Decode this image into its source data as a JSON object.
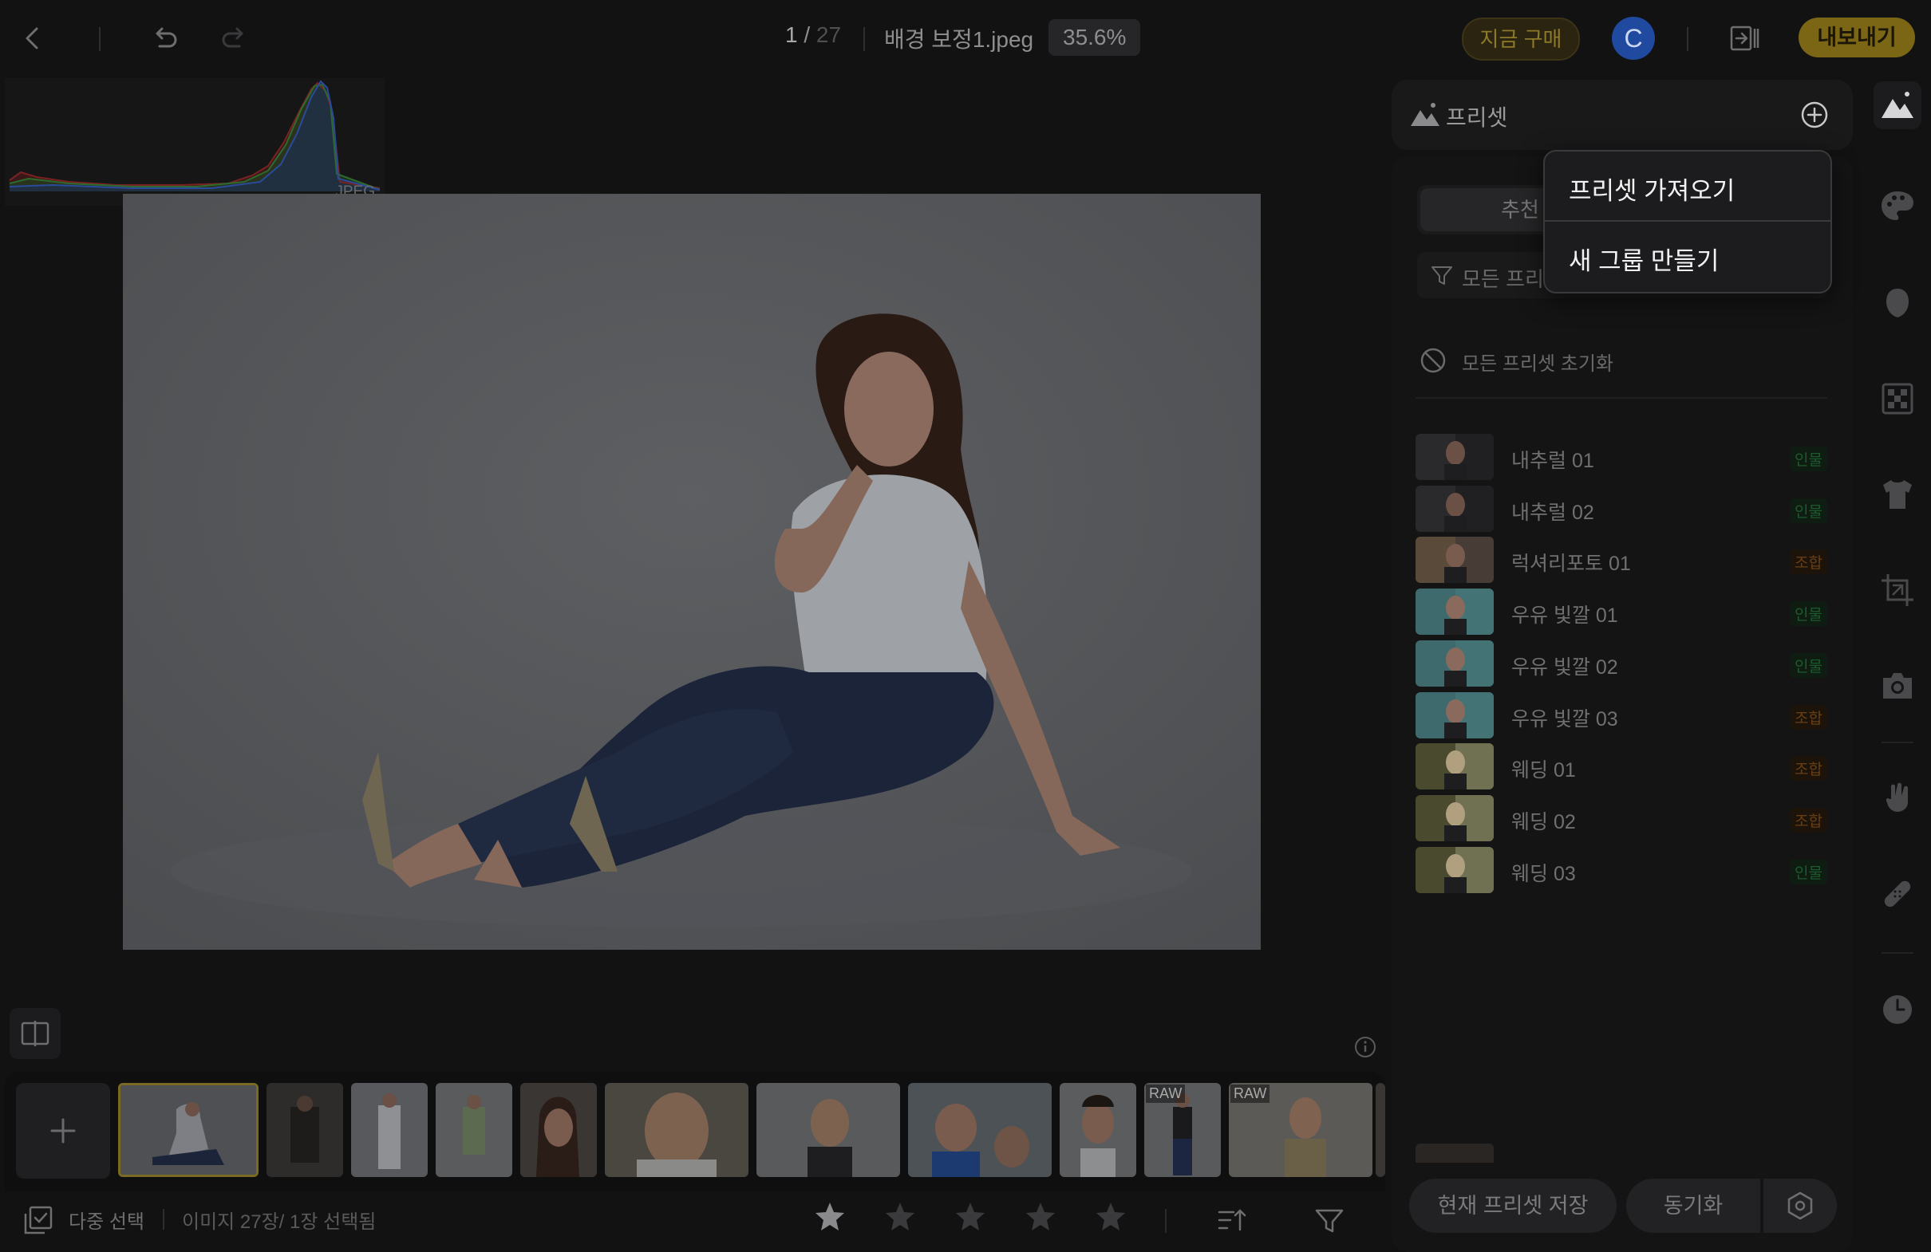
{
  "topbar": {
    "page_current": "1",
    "page_separator": " / ",
    "page_total": "27",
    "file_name": "배경 보정1.jpeg",
    "zoom": "35.6%",
    "buy_now": "지금 구매",
    "avatar_letter": "C",
    "export": "내보내기"
  },
  "histogram": {
    "label": "JPEG"
  },
  "filmstrip": {
    "thumbnails": [
      {
        "tag": ""
      },
      {
        "tag": ""
      },
      {
        "tag": ""
      },
      {
        "tag": ""
      },
      {
        "tag": ""
      },
      {
        "tag": ""
      },
      {
        "tag": ""
      },
      {
        "tag": ""
      },
      {
        "tag": ""
      },
      {
        "tag": "RAW"
      },
      {
        "tag": "RAW"
      }
    ]
  },
  "bottombar": {
    "multi_select": "다중 선택",
    "image_count": "이미지 27장/ 1장 선택됨",
    "rating": 1
  },
  "preset_panel": {
    "title": "프리셋",
    "tab_recommend": "추천",
    "filter_label": "모든 프리셋",
    "reset_all": "모든 프리셋 초기화",
    "presets": [
      {
        "name": "내추럴 01",
        "tag": "인물",
        "kind": "person"
      },
      {
        "name": "내추럴 02",
        "tag": "인물",
        "kind": "person"
      },
      {
        "name": "럭셔리포토 01",
        "tag": "조합",
        "kind": "comb"
      },
      {
        "name": "우유 빛깔 01",
        "tag": "인물",
        "kind": "person"
      },
      {
        "name": "우유 빛깔 02",
        "tag": "인물",
        "kind": "person"
      },
      {
        "name": "우유 빛깔 03",
        "tag": "조합",
        "kind": "comb"
      },
      {
        "name": "웨딩 01",
        "tag": "조합",
        "kind": "comb"
      },
      {
        "name": "웨딩 02",
        "tag": "조합",
        "kind": "comb"
      },
      {
        "name": "웨딩 03",
        "tag": "인물",
        "kind": "person"
      }
    ],
    "save_current": "현재 프리셋 저장",
    "sync": "동기화"
  },
  "dropdown": {
    "import_preset": "프리셋 가져오기",
    "new_group": "새 그룹 만들기"
  },
  "colors": {
    "accent_gold": "#7b6616",
    "avatar_blue": "#1f4aa0",
    "tag_person": "#1d5a2d",
    "tag_comb": "#6a3e12"
  }
}
